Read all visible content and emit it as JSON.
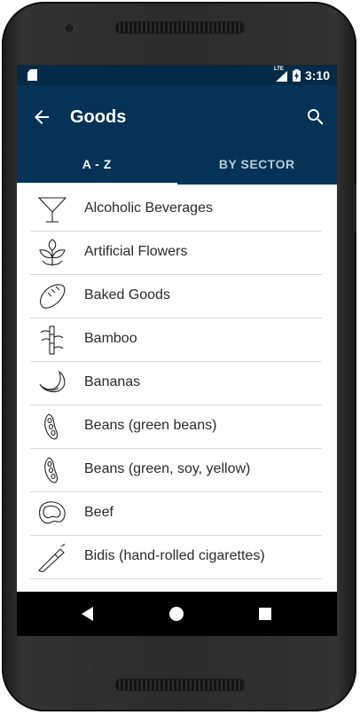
{
  "status_bar": {
    "network": "LTE",
    "time": "3:10"
  },
  "toolbar": {
    "title": "Goods",
    "back_icon": "arrow-back-icon",
    "search_icon": "search-icon"
  },
  "tabs": [
    {
      "label": "A - Z",
      "active": true
    },
    {
      "label": "BY SECTOR",
      "active": false
    }
  ],
  "items": [
    {
      "label": "Alcoholic Beverages",
      "icon": "cocktail-glass-icon"
    },
    {
      "label": "Artificial Flowers",
      "icon": "flower-leaves-icon"
    },
    {
      "label": "Baked Goods",
      "icon": "bread-icon"
    },
    {
      "label": "Bamboo",
      "icon": "bamboo-icon"
    },
    {
      "label": "Bananas",
      "icon": "banana-icon"
    },
    {
      "label": "Beans (green beans)",
      "icon": "bean-pod-icon"
    },
    {
      "label": "Beans (green, soy, yellow)",
      "icon": "bean-pod-icon"
    },
    {
      "label": "Beef",
      "icon": "steak-icon"
    },
    {
      "label": "Bidis (hand-rolled cigarettes)",
      "icon": "cigarette-icon"
    }
  ],
  "nav": {
    "back": "nav-back-icon",
    "home": "nav-home-icon",
    "recents": "nav-recents-icon"
  },
  "colors": {
    "toolbar": "#043357",
    "status_bar": "#022b4a",
    "text": "#2a2a2a",
    "divider": "#d9d9d9"
  }
}
